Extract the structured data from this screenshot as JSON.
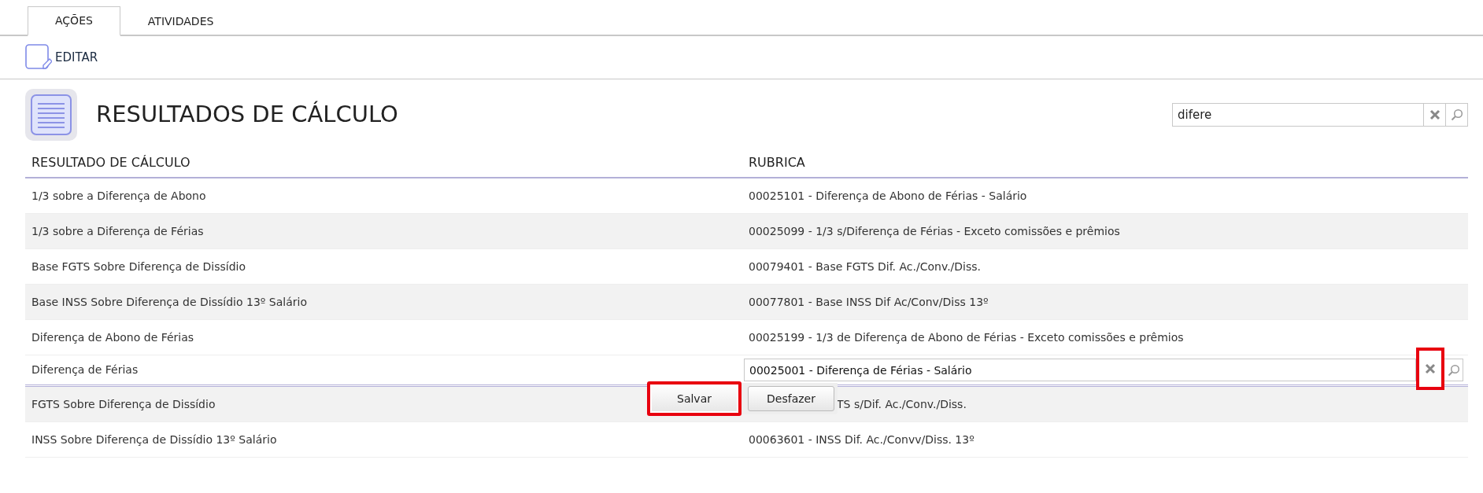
{
  "tabs": [
    {
      "label": "AÇÕES",
      "selected": true
    },
    {
      "label": "ATIVIDADES",
      "selected": false
    }
  ],
  "toolbar": {
    "edit_button": "EDITAR"
  },
  "header": {
    "title": "RESULTADOS DE CÁLCULO",
    "search": {
      "value": "difere"
    }
  },
  "table": {
    "columns": [
      "RESULTADO DE CÁLCULO",
      "RUBRICA"
    ],
    "rows": [
      {
        "kind": "view",
        "result": "1/3 sobre a Diferença de Abono",
        "rubrica": "00025101 - Diferença de Abono de Férias - Salário"
      },
      {
        "kind": "view",
        "result": "1/3 sobre a Diferença de Férias",
        "rubrica": "00025099 - 1/3 s/Diferença de Férias - Exceto comissões e prêmios"
      },
      {
        "kind": "view",
        "result": "Base FGTS Sobre Diferença de Dissídio",
        "rubrica": "00079401 - Base FGTS Dif. Ac./Conv./Diss."
      },
      {
        "kind": "view",
        "result": "Base INSS Sobre Diferença de Dissídio 13º Salário",
        "rubrica": "00077801 - Base INSS Dif Ac/Conv/Diss 13º"
      },
      {
        "kind": "view",
        "result": "Diferença de Abono de Férias",
        "rubrica": "00025199 - 1/3 de Diferença de Abono de Férias - Exceto comissões e prêmios"
      },
      {
        "kind": "edit",
        "result": "Diferença de Férias",
        "rubrica": "00025001 - Diferença de Férias - Salário",
        "clear_highlighted": true
      },
      {
        "kind": "covered",
        "result": "FGTS Sobre Diferença de Dissídio",
        "rubrica": "TS s/Dif. Ac./Conv./Diss."
      },
      {
        "kind": "view",
        "result": "INSS Sobre Diferença de Dissídio 13º Salário",
        "rubrica": "00063601 - INSS Dif. Ac./Convv/Diss. 13º"
      }
    ]
  },
  "edit_actions": [
    {
      "label": "Salvar",
      "highlighted": true
    },
    {
      "label": "Desfazer",
      "highlighted": false
    }
  ]
}
